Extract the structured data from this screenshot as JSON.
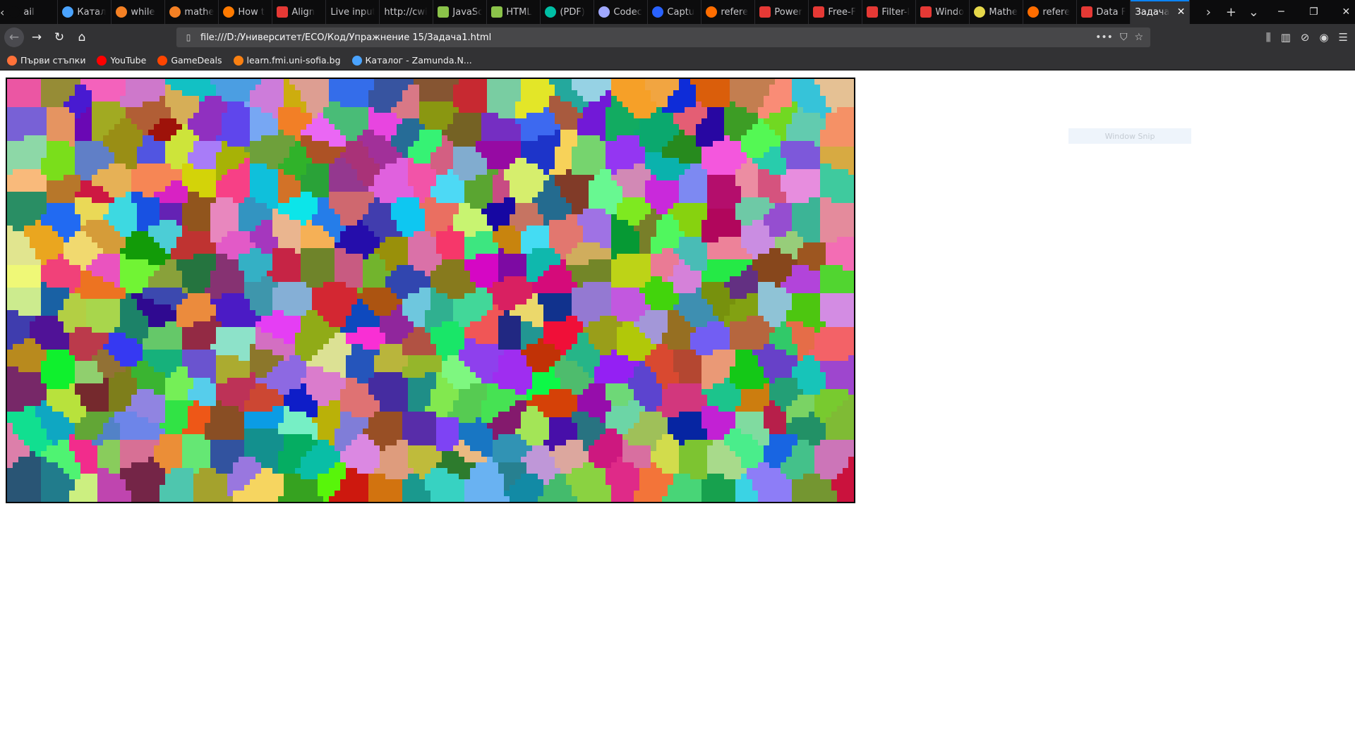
{
  "browser": {
    "tabs": [
      {
        "label": "ail",
        "icon": "partial-tab-icon",
        "color": "#0c0c0d"
      },
      {
        "label": "Катал",
        "icon": "globe-favicon",
        "color": "#4aa3ff"
      },
      {
        "label": "while",
        "icon": "orange-circle-favicon",
        "color": "#f48024"
      },
      {
        "label": "mathe",
        "icon": "orange-circle-favicon",
        "color": "#f48024"
      },
      {
        "label": "How t",
        "icon": "stackexchange-favicon",
        "color": "#ff7a00"
      },
      {
        "label": "Align",
        "icon": "red-gear-favicon",
        "color": "#e53935"
      },
      {
        "label": "Live input",
        "icon": "",
        "color": ""
      },
      {
        "label": "http://cwi",
        "icon": "",
        "color": ""
      },
      {
        "label": "JavaSc",
        "icon": "green-square-favicon",
        "color": "#8bc34a"
      },
      {
        "label": "HTML",
        "icon": "green-square-favicon",
        "color": "#8bc34a"
      },
      {
        "label": "(PDF)",
        "icon": "researchgate-favicon",
        "color": "#00bfa5"
      },
      {
        "label": "Codec",
        "icon": "discord-favicon",
        "color": "#a0a8ff"
      },
      {
        "label": "Captu",
        "icon": "css-shield-favicon",
        "color": "#2962ff"
      },
      {
        "label": "refere",
        "icon": "orange-burst-favicon",
        "color": "#ff6d00"
      },
      {
        "label": "Power",
        "icon": "red-gear-favicon",
        "color": "#e53935"
      },
      {
        "label": "Free-F",
        "icon": "red-gear-favicon",
        "color": "#e53935"
      },
      {
        "label": "Filter-l",
        "icon": "red-gear-favicon",
        "color": "#e53935"
      },
      {
        "label": "Windo",
        "icon": "red-gear-favicon",
        "color": "#e53935"
      },
      {
        "label": "Mathe",
        "icon": "bookmark-image-favicon",
        "color": "#e6d84a"
      },
      {
        "label": "refere",
        "icon": "orange-burst-favicon",
        "color": "#ff6d00"
      },
      {
        "label": "Data F",
        "icon": "red-gear-favicon",
        "color": "#e53935"
      },
      {
        "label": "Задача",
        "icon": "",
        "color": "",
        "active": true
      }
    ],
    "url": "file:///D:/Университет/ECO/Код/Упражнение 15/Задача1.html",
    "bookmarks": [
      {
        "label": "Първи стъпки",
        "icon": "firefox-favicon",
        "color": "#ff7139"
      },
      {
        "label": "YouTube",
        "icon": "youtube-favicon",
        "color": "#ff0000"
      },
      {
        "label": "GameDeals",
        "icon": "reddit-favicon",
        "color": "#ff4500"
      },
      {
        "label": "learn.fmi.uni-sofia.bg",
        "icon": "moodle-favicon",
        "color": "#f98012"
      },
      {
        "label": "Каталог - Zamunda.N...",
        "icon": "globe-favicon",
        "color": "#4aa3ff"
      }
    ]
  },
  "content": {
    "snip_label": "Window Snip",
    "canvas": {
      "description_colors": [
        "#e6194b",
        "#3cb44b",
        "#ffe119",
        "#4363d8",
        "#f58231",
        "#911eb4",
        "#46f0f0",
        "#f032e6",
        "#bcf60c",
        "#fabebe",
        "#008080",
        "#e6beff",
        "#9a6324",
        "#800000",
        "#aaffc3",
        "#808000",
        "#000075",
        "#1e90ff",
        "#ff69b4",
        "#32cd32",
        "#ffd700",
        "#00ced1",
        "#dc143c",
        "#7b68ee"
      ],
      "seed": 42
    }
  }
}
